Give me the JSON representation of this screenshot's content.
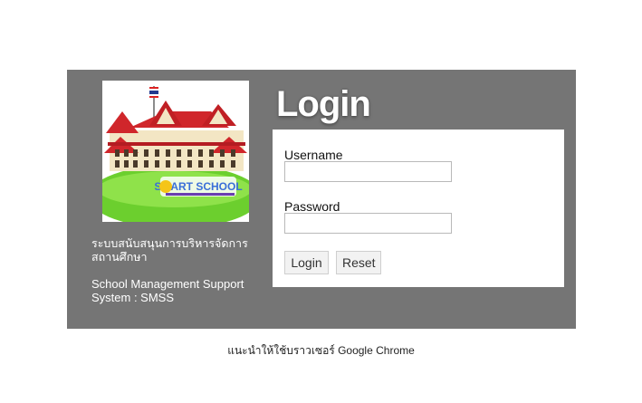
{
  "sidebar": {
    "logo_text": "SMART SCHOOL",
    "system_name_th": "ระบบสนับสนุนการบริหารจัดการสถานศึกษา",
    "system_name_en": "School Management Support System : SMSS"
  },
  "login": {
    "title": "Login",
    "username_label": "Username",
    "username_value": "",
    "password_label": "Password",
    "password_value": "",
    "login_button": "Login",
    "reset_button": "Reset"
  },
  "footer": {
    "note": "แนะนำให้ใช้บราวเซอร์ Google Chrome"
  },
  "colors": {
    "panel_bg": "#757575",
    "roof_red": "#d0262b",
    "grass_green": "#6ccf2e"
  }
}
